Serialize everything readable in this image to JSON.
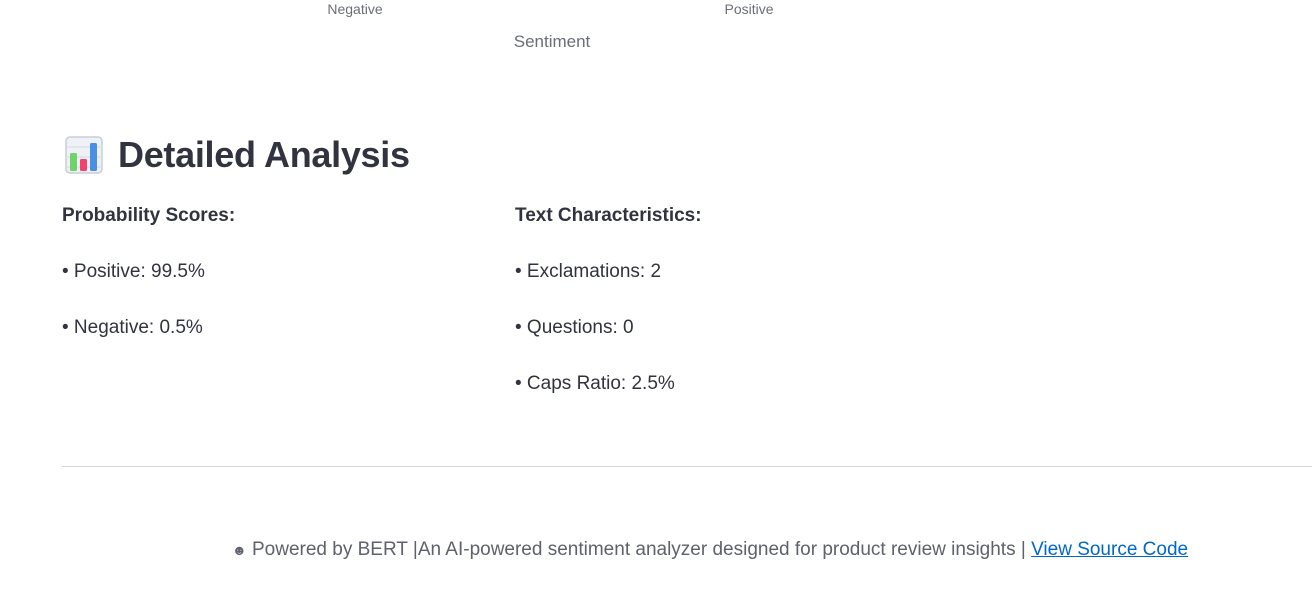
{
  "chart": {
    "tick_labels": [
      "Negative",
      "Positive"
    ],
    "axis_title": "Sentiment"
  },
  "section": {
    "icon": "bar-chart-icon",
    "title": "Detailed Analysis"
  },
  "probability": {
    "title": "Probability Scores:",
    "items": [
      "• Positive: 99.5%",
      "• Negative: 0.5%"
    ]
  },
  "characteristics": {
    "title": "Text Characteristics:",
    "items": [
      "• Exclamations: 2",
      "• Questions: 0",
      "• Caps Ratio: 2.5%"
    ]
  },
  "footer": {
    "icon": "robot-icon",
    "text": "Powered by BERT |An AI-powered sentiment analyzer designed for product review insights | ",
    "link_label": "View Source Code"
  },
  "colors": {
    "text": "#31333f",
    "muted": "#6b6e78",
    "link": "#0068c9",
    "divider": "#d6d6d9"
  }
}
